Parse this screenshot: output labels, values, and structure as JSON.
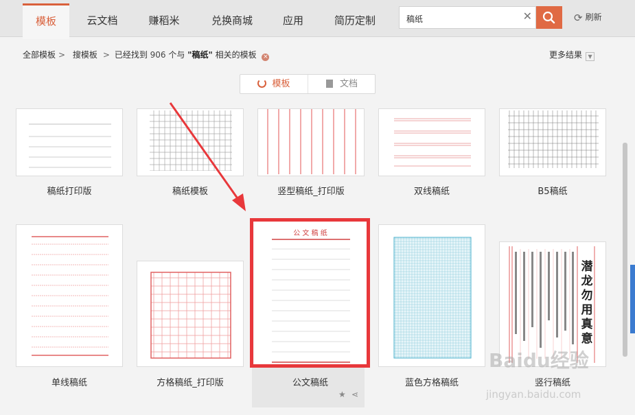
{
  "nav": {
    "tabs": [
      "模板",
      "云文档",
      "赚稻米",
      "兑换商城",
      "应用",
      "简历定制"
    ],
    "active_index": 0,
    "search_value": "稿纸",
    "refresh_label": "刷新",
    "accent_color": "#d9603b"
  },
  "breadcrumb": {
    "all": "全部模板",
    "search": "搜模板",
    "prefix": "已经找到",
    "count": "906",
    "middle": "个与",
    "keyword": "\"稿纸\"",
    "suffix": "相关的模板"
  },
  "more_results": "更多结果",
  "toggle": {
    "template": "模板",
    "document": "文档"
  },
  "cards": [
    {
      "title": "稿纸打印版"
    },
    {
      "title": "稿纸模板"
    },
    {
      "title": "竖型稿纸_打印版"
    },
    {
      "title": "双线稿纸"
    },
    {
      "title": "B5稿纸"
    },
    {
      "title": "单线稿纸"
    },
    {
      "title": "方格稿纸_打印版"
    },
    {
      "title": "公文稿纸",
      "thumb_heading": "公 文 稿 纸"
    },
    {
      "title": "蓝色方格稿纸"
    },
    {
      "title": "竖行稿纸",
      "thumb_text": [
        "潜",
        "龙",
        "勿",
        "用",
        "真",
        "意"
      ]
    }
  ],
  "watermark": {
    "brand": "Baidu经验",
    "url": "jingyan.baidu.com"
  }
}
